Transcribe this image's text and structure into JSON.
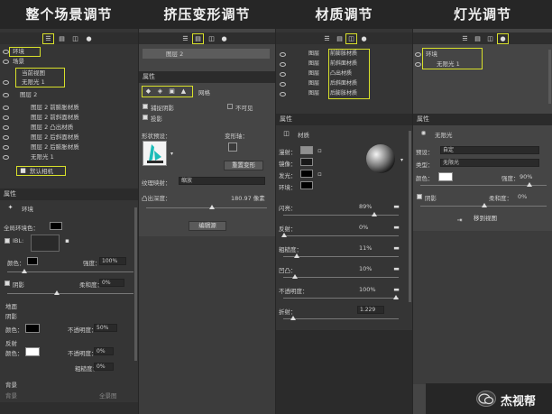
{
  "columns": [
    {
      "title": "整个场景调节"
    },
    {
      "title": "挤压变形调节"
    },
    {
      "title": "材质调节"
    },
    {
      "title": "灯光调节"
    }
  ],
  "scene": {
    "root": "环境",
    "scene_label": "场景",
    "current_view": "当前视图",
    "infinite_light": "无限光 1",
    "layer_group": "图层 2",
    "children": [
      "图层 2 前膨胀材质",
      "图层 2 前斜面材质",
      "图层 2 凸出材质",
      "图层 2 后斜面材质",
      "图层 2 后膨胀材质",
      "无限光 1"
    ],
    "default_camera": "默认相机"
  },
  "props_env": {
    "header": "属性",
    "tab": "环境",
    "global_ambient": "全局环境色：",
    "ibl": "IBL:",
    "color": "颜色：",
    "intensity": "强度：",
    "intensity_val": "100%",
    "shadow": "阴影",
    "softness": "柔和度：",
    "softness_val": "0%",
    "ground": "地面",
    "shadow2": "阴影",
    "color2": "颜色：",
    "opacity": "不透明度：",
    "opacity_val": "50%",
    "reflect": "反射",
    "color3": "颜色：",
    "opacity2": "不透明度：",
    "opacity2_val": "0%",
    "roughness": "粗糙度：",
    "roughness_val": "0%",
    "bg": "背景",
    "bg_sub": "背景",
    "panorama": "全景图"
  },
  "extrude": {
    "layer": "图层 2",
    "header": "属性",
    "tab": "网格",
    "capture_shadow": "捕捉阴影",
    "invisible": "不可见",
    "cast_shadow": "投影",
    "preset_label": "形状预设：",
    "deform_axis": "变形轴：",
    "reset_btn": "重置变形",
    "texture_map": "纹理映射：",
    "texture_val": "缩放",
    "depth_label": "凸出深度：",
    "depth_val": "180.97 像素",
    "edit_btn": "编辑源"
  },
  "material": {
    "layers": [
      "前膨胀材质",
      "前斜面材质",
      "凸出材质",
      "后斜面材质",
      "后膨胀材质"
    ],
    "header": "属性",
    "tab": "材质",
    "diffuse": "漫射：",
    "specular": "镜像：",
    "glow": "发光：",
    "ambient": "环境：",
    "shine": "闪亮：",
    "shine_val": "89%",
    "reflection": "反射：",
    "reflection_val": "0%",
    "roughness": "粗糙度：",
    "roughness_val": "11%",
    "bump": "凹凸：",
    "bump_val": "10%",
    "opacity": "不透明度：",
    "opacity_val": "100%",
    "refraction": "折射：",
    "refraction_val": "1.229"
  },
  "light": {
    "root": "环境",
    "child": "无限光 1",
    "header": "属性",
    "tab": "无限光",
    "preset": "预设：",
    "preset_val": "自定",
    "type": "类型：",
    "type_val": "无限光",
    "color": "颜色：",
    "intensity": "强度：",
    "intensity_val": "90%",
    "shadow": "阴影",
    "softness": "柔和度：",
    "softness_val": "0%",
    "move_btn": "移到视图"
  },
  "watermark": "杰视帮",
  "colors": {
    "accent": "#d8e02a",
    "panel": "#353535",
    "panel_light": "#454545",
    "bg": "#262626"
  }
}
